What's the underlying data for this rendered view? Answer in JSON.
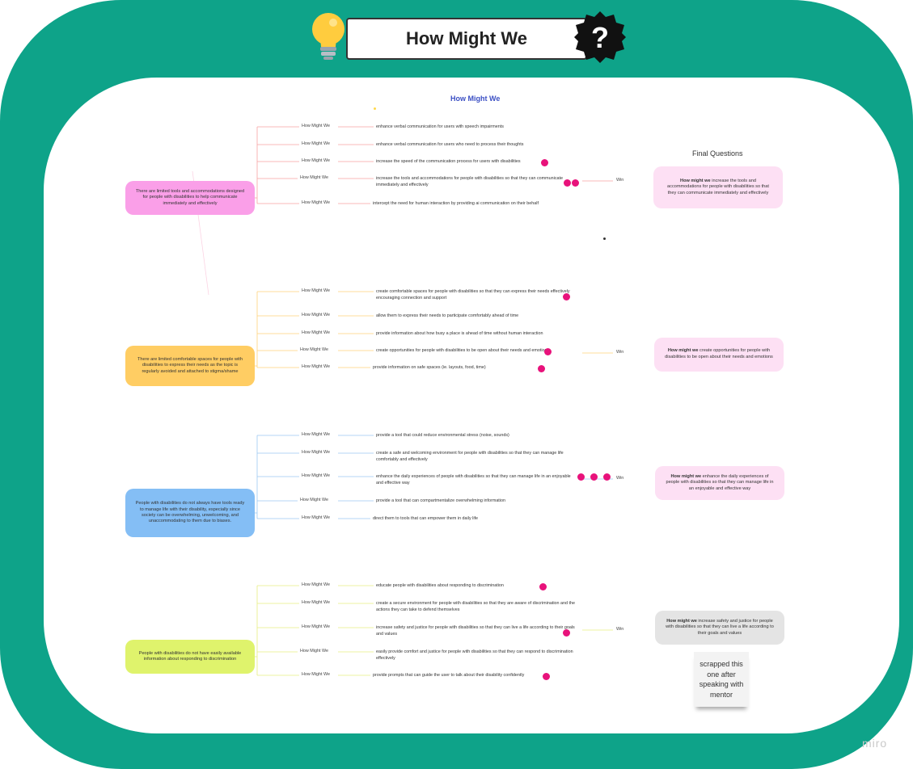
{
  "header": {
    "title": "How Might We"
  },
  "board": {
    "title": "How Might We",
    "final_questions_label": "Final Questions"
  },
  "hmw_label": "How Might We",
  "win_label": "Win",
  "groups": [
    {
      "color": "#fa9fe8",
      "problem": "There are limited tools and accommodations designed for people with disabilities to help communicate immediately and effectively",
      "ideas": [
        {
          "text": "enhance verbal communication for users with speech impairments",
          "votes": 0
        },
        {
          "text": "enhance verbal communication for users who need to process their thoughts",
          "votes": 0
        },
        {
          "text": "increase the speed of the communication process for users with disabilities",
          "votes": 1
        },
        {
          "text": "increase the tools and accommodations for people with disabilities so that they can communicate immediately and effectively",
          "votes": 2,
          "win": true
        },
        {
          "text": "intercept the need for human interaction by providing ai communication on their behalf",
          "votes": 0
        }
      ],
      "final": {
        "lead": "How might we",
        "text": " increase the tools and accommodations for people with disabilities so that they can communicate immediately and effectively",
        "color": "#fde0f4"
      }
    },
    {
      "color": "#ffcd63",
      "problem": "There are limited comfortable spaces for people with disabilities to express their needs as the topic is regularly avoided and attached to stigma/shame",
      "ideas": [
        {
          "text": "create comfortable spaces for people with disabilities so that they can express their needs effectively encouraging connection and support",
          "votes": 1
        },
        {
          "text": "allow them to express their needs to participate comfortably ahead of time",
          "votes": 0
        },
        {
          "text": "provide information about how busy a place is ahead of time without human interaction",
          "votes": 0
        },
        {
          "text": "create opportunities for people with disabilities to be open about their needs and emotions",
          "votes": 1,
          "win": true
        },
        {
          "text": "provide information on safe spaces (ie. layouts, food, time)",
          "votes": 1
        }
      ],
      "final": {
        "lead": "How might we",
        "text": " create opportunities for people with disabilities to be open about their needs and emotions",
        "color": "#fde0f4"
      }
    },
    {
      "color": "#84bef5",
      "problem": "People with disabilities do not always have tools ready to manage life with their disability, especially since society can be overwhelming, unwelcoming, and unaccommodating to them due to biases.",
      "ideas": [
        {
          "text": "provide a tool that could reduce environmental stress (noise, sounds)",
          "votes": 0
        },
        {
          "text": "create a safe and welcoming environment for people with disabilities so that they can manage life comfortably and effectively",
          "votes": 0
        },
        {
          "text": "enhance the daily experiences of people with disabilities so that they can manage life in an enjoyable and effective way",
          "votes": 3,
          "win": true
        },
        {
          "text": "provide a tool that can compartmentalize overwhelming information",
          "votes": 0
        },
        {
          "text": "direct them to tools that can empower them in daily life",
          "votes": 0
        }
      ],
      "final": {
        "lead": "How might we",
        "text": " enhance the daily experiences of people with disabilities so that they can manage life in an enjoyable and effective way",
        "color": "#fde0f4"
      }
    },
    {
      "color": "#dff36c",
      "problem": "People with disabilities do not have easily available information about responding to discrimination",
      "ideas": [
        {
          "text": "educate people with disabilities about responding to discrimination",
          "votes": 1
        },
        {
          "text": "create a secure environment for people with disabilities so that they are aware of discrimination and the actions they can take to defend themselves",
          "votes": 0
        },
        {
          "text": "increase safety and justice for people with disabilities so that they can live a life according to their goals and values",
          "votes": 1,
          "win": true
        },
        {
          "text": "easily provide comfort and justice for people with disabilities so that they can respond to discrimination effectively",
          "votes": 0
        },
        {
          "text": "provide prompts that can guide the user to talk about their disability confidently",
          "votes": 1
        }
      ],
      "final": {
        "lead": "How might we",
        "text": " increase safety and justice for people with disabilities so that they can live a life according to their goals and values",
        "color": "#e4e4e4"
      }
    }
  ],
  "sticky_note": "scrapped this one after speaking with mentor",
  "watermark": "miro",
  "colors": {
    "frame": "#0ea389",
    "vote_dot": "#e8127b",
    "board_title": "#3b4fc4"
  }
}
